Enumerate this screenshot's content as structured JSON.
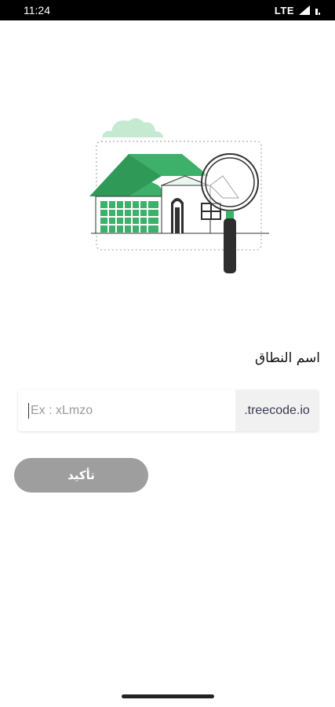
{
  "status_bar": {
    "time": "11:24",
    "network": "LTE",
    "icons": [
      "signal-icon",
      "battery-icon"
    ]
  },
  "illustration": {
    "name": "house-search-illustration",
    "accent_color": "#3db06a"
  },
  "form": {
    "label": "اسم النطاق",
    "input_placeholder": "Ex : xLmzo",
    "input_value": "",
    "domain_suffix": ".treecode.io"
  },
  "confirm_button": {
    "label": "تأكيد",
    "color": "#9e9e9e"
  }
}
